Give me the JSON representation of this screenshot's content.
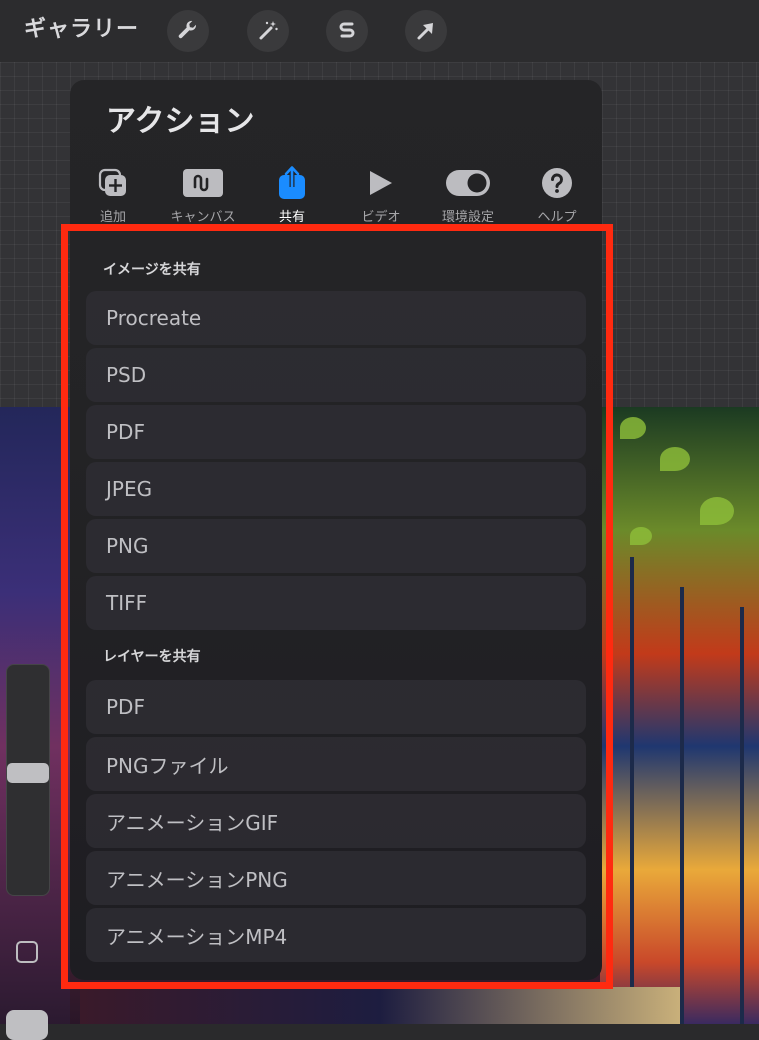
{
  "toolbar": {
    "gallery_label": "ギャラリー",
    "tools": [
      {
        "name": "wrench-icon"
      },
      {
        "name": "magic-wand-icon"
      },
      {
        "name": "selection-icon"
      },
      {
        "name": "transform-arrow-icon"
      }
    ]
  },
  "actions_panel": {
    "title": "アクション",
    "tabs": [
      {
        "label": "追加",
        "icon": "add-icon"
      },
      {
        "label": "キャンバス",
        "icon": "canvas-icon"
      },
      {
        "label": "共有",
        "icon": "share-icon",
        "active": true
      },
      {
        "label": "ビデオ",
        "icon": "play-icon"
      },
      {
        "label": "環境設定",
        "icon": "toggle-icon"
      },
      {
        "label": "ヘルプ",
        "icon": "help-icon"
      }
    ],
    "share_image": {
      "header": "イメージを共有",
      "items": [
        "Procreate",
        "PSD",
        "PDF",
        "JPEG",
        "PNG",
        "TIFF"
      ]
    },
    "share_layers": {
      "header": "レイヤーを共有",
      "items": [
        "PDF",
        "PNGファイル",
        "アニメーションGIF",
        "アニメーションPNG",
        "アニメーションMP4"
      ]
    }
  },
  "colors": {
    "accent": "#1a8cff",
    "highlight_border": "#ff2a10"
  }
}
